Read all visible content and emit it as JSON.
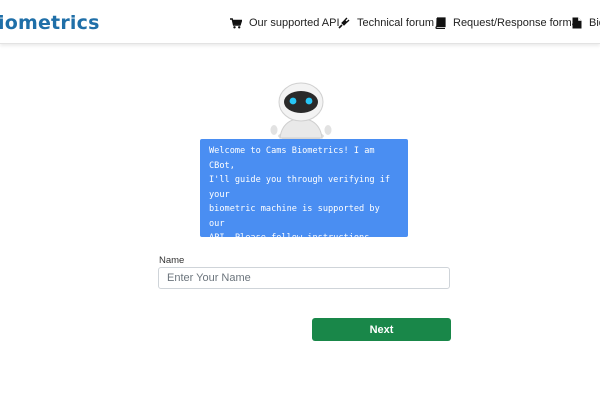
{
  "header": {
    "logo_text": "iometrics",
    "nav": [
      {
        "label": "Our supported API",
        "icon": "cart-icon"
      },
      {
        "label": "Technical forum",
        "icon": "plug-icon"
      },
      {
        "label": "Request/Response format",
        "icon": "book-icon"
      },
      {
        "label": "Bio",
        "icon": "document-icon"
      }
    ]
  },
  "chatbot": {
    "message": "Welcome to Cams Biometrics! I am CBot,\nI'll guide you through verifying if your\nbiometric machine is supported by our\nAPI. Please follow instructions\ncarefully for quick verification. Let's\nbegin!"
  },
  "form": {
    "name_label": "Name",
    "name_placeholder": "Enter Your Name",
    "name_value": "",
    "next_label": "Next"
  },
  "colors": {
    "brand": "#1f6fa8",
    "bubble": "#4a8ef2",
    "next_button": "#198749"
  }
}
